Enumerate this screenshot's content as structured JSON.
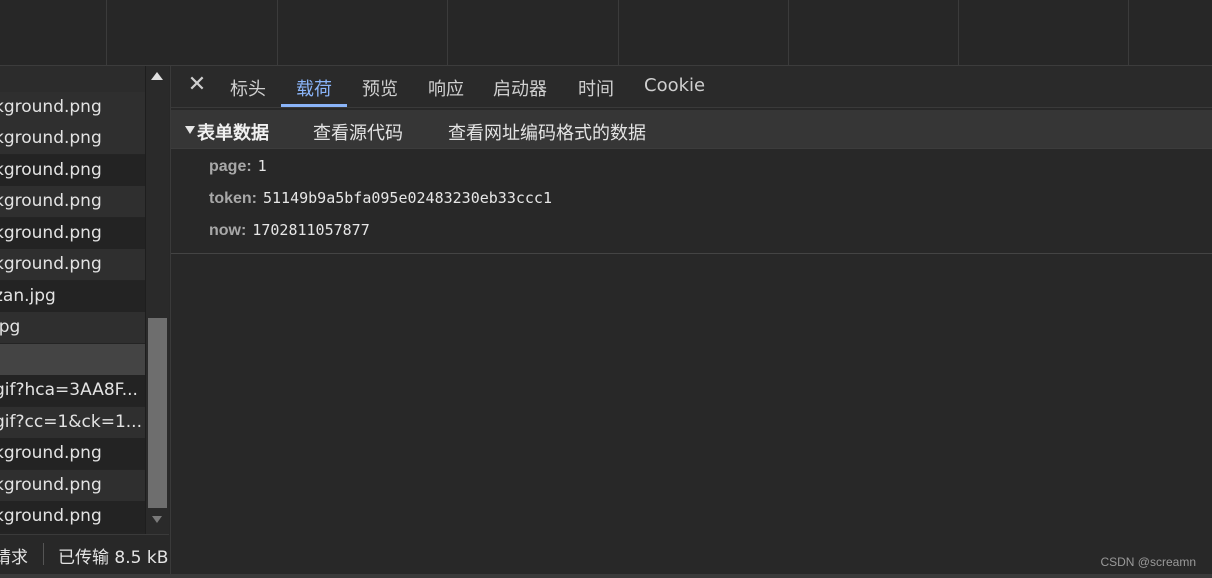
{
  "request_list": {
    "files": [
      "kground.png",
      "kground.png",
      "kground.png",
      "kground.png",
      "kground.png",
      "kground.png",
      "zan.jpg",
      "jpg",
      "",
      "gif?hca=3AA8F...",
      "gif?cc=1&ck=1...",
      "kground.png",
      "kground.png",
      "kground.png"
    ]
  },
  "status_bar": {
    "requests": "请求",
    "transferred": "已传输 8.5 kB"
  },
  "detail": {
    "close_glyph": "✕",
    "tabs": [
      {
        "label": "标头"
      },
      {
        "label": "载荷"
      },
      {
        "label": "预览"
      },
      {
        "label": "响应"
      },
      {
        "label": "启动器"
      },
      {
        "label": "时间"
      },
      {
        "label": "Cookie"
      }
    ],
    "active_tab": "载荷",
    "section": {
      "title": "表单数据",
      "view_source": "查看源代码",
      "view_url_encoded": "查看网址编码格式的数据"
    },
    "form_data": [
      {
        "key": "page:",
        "value": "1"
      },
      {
        "key": "token:",
        "value": "51149b9a5bfa095e02483230eb33ccc1"
      },
      {
        "key": "now:",
        "value": "1702811057877"
      }
    ]
  },
  "watermark": "CSDN @screamn",
  "colors": {
    "background": "#282828",
    "accent": "#8ab4f8",
    "selected_row": "#444444"
  },
  "icons": [
    "close-icon",
    "expand-triangle-icon",
    "scroll-up-icon",
    "scroll-down-icon"
  ]
}
